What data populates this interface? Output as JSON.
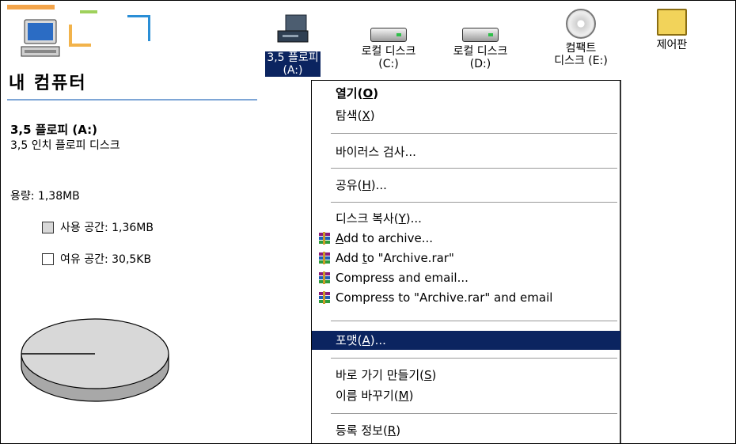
{
  "window": {
    "title": "내 컴퓨터"
  },
  "icons": [
    {
      "label": "3,5 플로피 (A:)",
      "line1": "3,5 플로피",
      "line2": "(A:)",
      "selected": true,
      "icon": "floppy-drive-icon"
    },
    {
      "label": "로컬 디스크 (C:)",
      "line1": "로컬 디스크",
      "line2": "(C:)",
      "icon": "hard-disk-icon"
    },
    {
      "label": "로컬 디스크 (D:)",
      "line1": "로컬 디스크",
      "line2": "(D:)",
      "icon": "hard-disk-icon"
    },
    {
      "label": "컴팩트 디스크 (E:)",
      "line1": "컴팩트",
      "line2": "디스크 (E:)",
      "icon": "cd-drive-icon"
    },
    {
      "label": "제어판",
      "line1": "제어판",
      "icon": "control-panel-icon"
    }
  ],
  "details": {
    "drive_title": "3,5 플로피 (A:)",
    "drive_subtitle": "3,5 인치 플로피 디스크",
    "capacity": "용량: 1,38MB",
    "used": "사용 공간: 1,36MB",
    "free": "여유 공간: 30,5KB",
    "used_fraction": 0.978
  },
  "menu": {
    "open": {
      "text": "열기(",
      "key": "O",
      "end": ")"
    },
    "explore": {
      "text": "탐색(",
      "key": "X",
      "end": ")"
    },
    "virus_scan": "바이러스 검사...",
    "share": {
      "text": "공유(",
      "key": "H",
      "end": ")..."
    },
    "copy_disk": {
      "text": "디스크 복사(",
      "key": "Y",
      "end": ")..."
    },
    "add_archive": {
      "key": "A",
      "text": "dd to archive..."
    },
    "add_to_rar": {
      "pre": "Add ",
      "key": "t",
      "text": "o \"Archive.rar\""
    },
    "compress_email": "Compress and email...",
    "compress_rar_email": "Compress to \"Archive.rar\" and email",
    "format": {
      "text": "포맷(",
      "key": "A",
      "end": ")..."
    },
    "shortcut": {
      "text": "바로 가기 만들기(",
      "key": "S",
      "end": ")"
    },
    "rename": {
      "text": "이름 바꾸기(",
      "key": "M",
      "end": ")"
    },
    "properties": {
      "text": "등록 정보(",
      "key": "R",
      "end": ")"
    }
  },
  "colors": {
    "selection": "#0b2460",
    "header_line": "#7ea6d6",
    "used_space": "#d8d8d8"
  }
}
